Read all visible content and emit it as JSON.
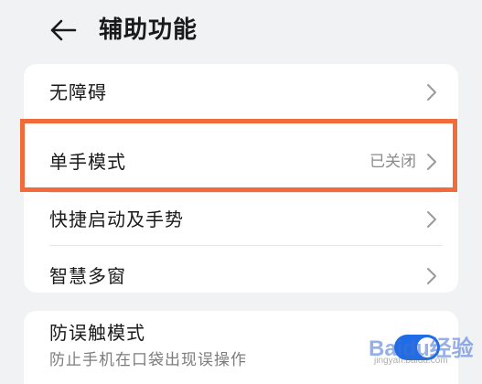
{
  "header": {
    "title": "辅助功能",
    "back_icon": "arrow-left-icon"
  },
  "list": {
    "items": [
      {
        "label": "无障碍",
        "value": ""
      },
      {
        "label": "单手模式",
        "value": "已关闭"
      },
      {
        "label": "快捷启动及手势",
        "value": ""
      },
      {
        "label": "智慧多窗",
        "value": ""
      }
    ]
  },
  "toggle_item": {
    "label": "防误触模式",
    "sublabel": "防止手机在口袋出现误操作",
    "enabled": true
  },
  "highlight": {
    "color": "#f26b3a"
  },
  "watermark": {
    "text": "Baidu经验",
    "sub": "jingyan.baidu.com"
  },
  "colors": {
    "background": "#f1f2f4",
    "card": "#ffffff",
    "accent": "#1f6de6"
  }
}
